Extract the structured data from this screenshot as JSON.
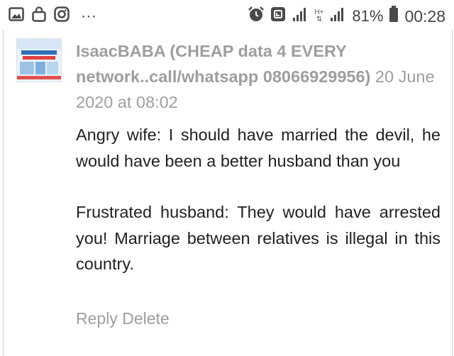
{
  "statusbar": {
    "left_icons": [
      "image-icon",
      "bag-icon",
      "instagram-icon"
    ],
    "overflow": "⋯",
    "network_label": "H+",
    "battery_percent": "81%",
    "time": "00:28"
  },
  "comment": {
    "author": "IsaacBABA (CHEAP data 4 EVERY network..call/whatsapp 08066929956)",
    "date": "20 June 2020 at 08:02",
    "paragraphs": [
      "Angry wife: I should have married the devil, he would have been a better husband than you",
      "Frustrated husband: They would have arrested you! Marriage between relatives is illegal in this country."
    ],
    "actions": {
      "reply": "Reply",
      "delete": "Delete"
    }
  }
}
